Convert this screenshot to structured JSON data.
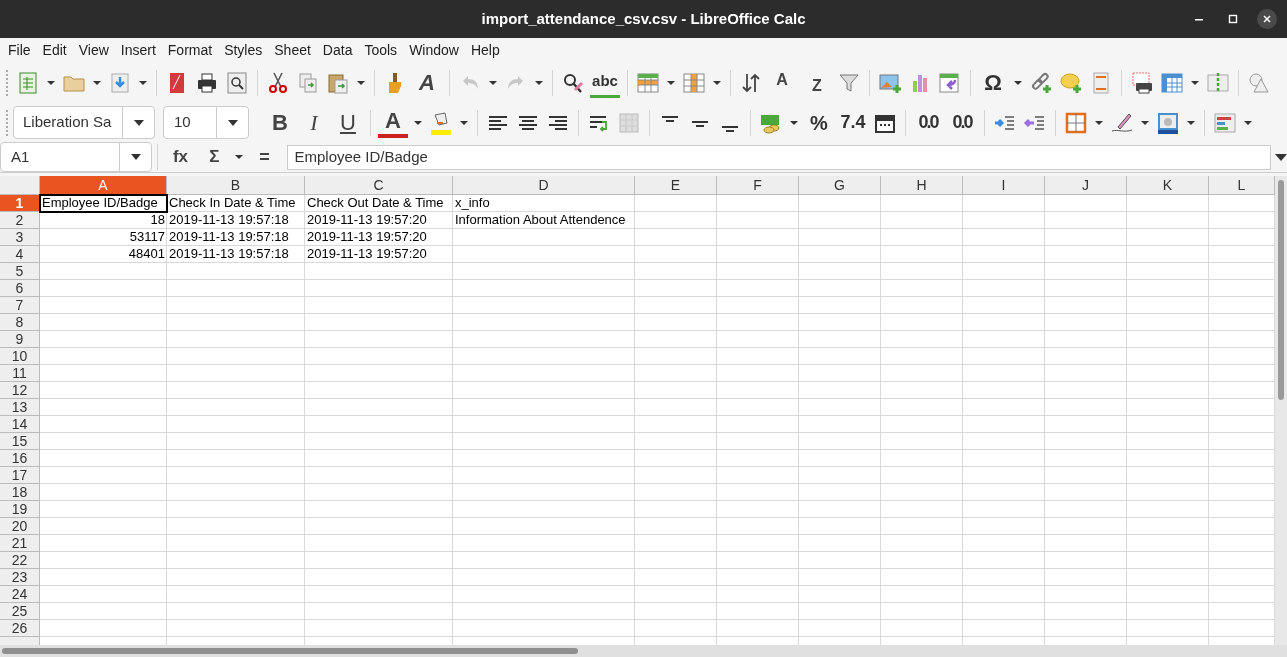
{
  "window": {
    "title": "import_attendance_csv.csv - LibreOffice Calc"
  },
  "menu": [
    "File",
    "Edit",
    "View",
    "Insert",
    "Format",
    "Styles",
    "Sheet",
    "Data",
    "Tools",
    "Window",
    "Help"
  ],
  "glyphs": {
    "clear_formatting": "A",
    "spelling": "abc",
    "sort_ascending": "A",
    "sort_descending": "Z",
    "special_character": "Ω",
    "bold": "B",
    "italic": "I",
    "underline": "U",
    "font_color": "A",
    "percent": "%",
    "number": "7.4",
    "add_decimal": "0.0",
    "delete_decimal": "0.0",
    "function_wizard": "fx",
    "sum": "Σ",
    "formula": "="
  },
  "font_name": {
    "value": "Liberation Sa"
  },
  "font_size": {
    "value": "10"
  },
  "name_box": {
    "value": "A1"
  },
  "formula_input": {
    "value": "Employee ID/Badge"
  },
  "columns": [
    {
      "label": "A",
      "selected": true
    },
    {
      "label": "B",
      "selected": false
    },
    {
      "label": "C",
      "selected": false
    },
    {
      "label": "D",
      "selected": false
    },
    {
      "label": "E",
      "selected": false
    },
    {
      "label": "F",
      "selected": false
    },
    {
      "label": "G",
      "selected": false
    },
    {
      "label": "H",
      "selected": false
    },
    {
      "label": "I",
      "selected": false
    },
    {
      "label": "J",
      "selected": false
    },
    {
      "label": "K",
      "selected": false
    },
    {
      "label": "L",
      "selected": false
    }
  ],
  "rows": [
    {
      "label": "1",
      "selected": true,
      "cells": [
        {
          "text": "Employee ID/Badge",
          "kind": "text",
          "active": true
        },
        {
          "text": "Check In Date & Time",
          "kind": "text",
          "active": false
        },
        {
          "text": "Check Out Date & Time",
          "kind": "text",
          "active": false
        },
        {
          "text": "x_info",
          "kind": "text",
          "active": false
        }
      ]
    },
    {
      "label": "2",
      "selected": false,
      "cells": [
        {
          "text": "18",
          "kind": "number",
          "active": false
        },
        {
          "text": "2019-11-13 19:57:18",
          "kind": "text",
          "active": false
        },
        {
          "text": "2019-11-13 19:57:20",
          "kind": "text",
          "active": false
        },
        {
          "text": "Information About Attendence",
          "kind": "text",
          "active": false
        }
      ]
    },
    {
      "label": "3",
      "selected": false,
      "cells": [
        {
          "text": "53117",
          "kind": "number",
          "active": false
        },
        {
          "text": "2019-11-13 19:57:18",
          "kind": "text",
          "active": false
        },
        {
          "text": "2019-11-13 19:57:20",
          "kind": "text",
          "active": false
        }
      ]
    },
    {
      "label": "4",
      "selected": false,
      "cells": [
        {
          "text": "48401",
          "kind": "number",
          "active": false
        },
        {
          "text": "2019-11-13 19:57:18",
          "kind": "text",
          "active": false
        },
        {
          "text": "2019-11-13 19:57:20",
          "kind": "text",
          "active": false
        }
      ]
    },
    {
      "label": "5",
      "selected": false
    },
    {
      "label": "6",
      "selected": false
    },
    {
      "label": "7",
      "selected": false
    },
    {
      "label": "8",
      "selected": false
    },
    {
      "label": "9",
      "selected": false
    },
    {
      "label": "10",
      "selected": false
    },
    {
      "label": "11",
      "selected": false
    },
    {
      "label": "12",
      "selected": false
    },
    {
      "label": "13",
      "selected": false
    },
    {
      "label": "14",
      "selected": false
    },
    {
      "label": "15",
      "selected": false
    },
    {
      "label": "16",
      "selected": false
    },
    {
      "label": "17",
      "selected": false
    },
    {
      "label": "18",
      "selected": false
    },
    {
      "label": "19",
      "selected": false
    },
    {
      "label": "20",
      "selected": false
    },
    {
      "label": "21",
      "selected": false
    },
    {
      "label": "22",
      "selected": false
    },
    {
      "label": "23",
      "selected": false
    },
    {
      "label": "24",
      "selected": false
    },
    {
      "label": "25",
      "selected": false
    },
    {
      "label": "26",
      "selected": false
    }
  ]
}
